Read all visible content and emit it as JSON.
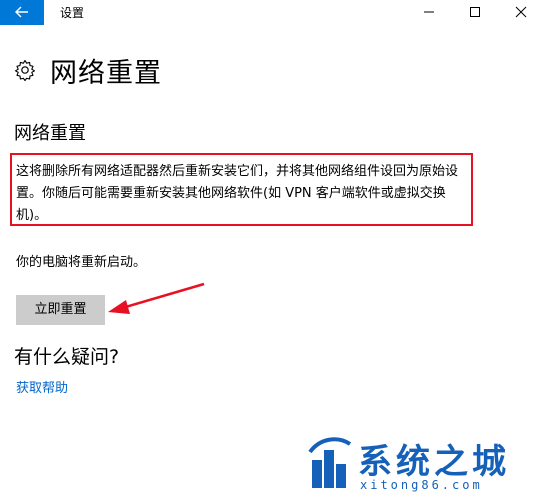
{
  "window": {
    "title": "设置"
  },
  "page": {
    "header_title": "网络重置",
    "section_title": "网络重置",
    "description": "这将删除所有网络适配器然后重新安装它们，并将其他网络组件设回为原始设置。你随后可能需要重新安装其他网络软件(如 VPN 客户端软件或虚拟交换机)。",
    "restart_note": "你的电脑将重新启动。",
    "reset_button_label": "立即重置"
  },
  "faq": {
    "title": "有什么疑问?",
    "help_link": "获取帮助"
  },
  "watermark": {
    "name": "系统之城",
    "url": "xitong86.com"
  },
  "icons": {
    "back": "back-arrow-icon",
    "minimize": "minimize-icon",
    "maximize": "maximize-icon",
    "close": "close-icon",
    "header": "gear-icon"
  },
  "colors": {
    "accent": "#0078d7",
    "highlight_border": "#e81123",
    "link": "#0066cc",
    "button_bg": "#cccccc",
    "watermark": "#1560b8"
  }
}
